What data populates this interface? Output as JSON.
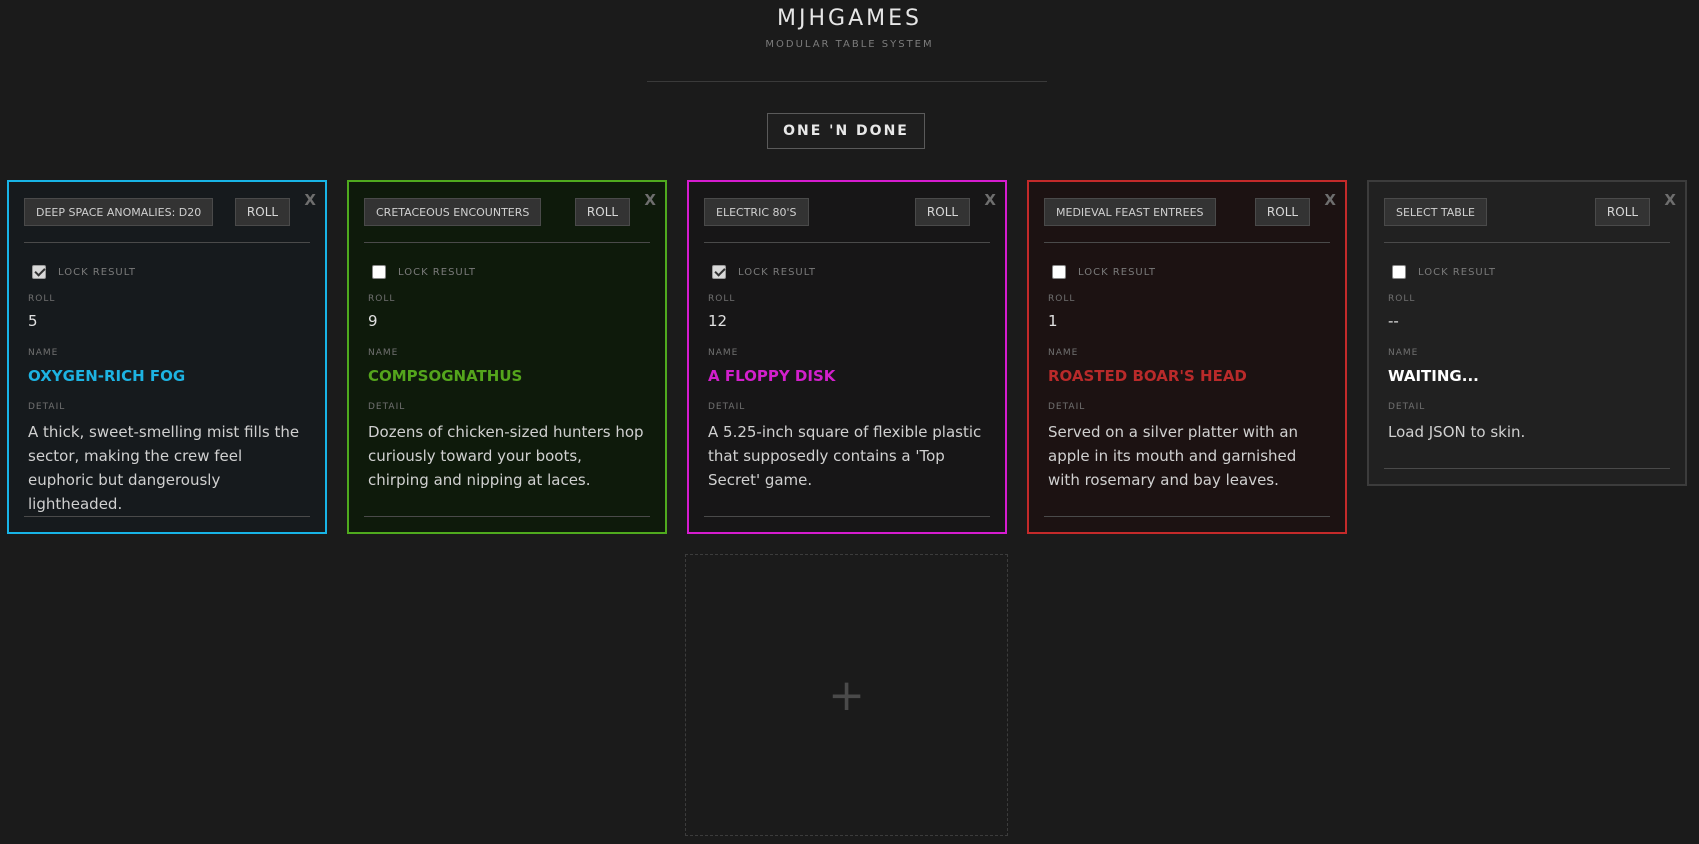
{
  "header": {
    "title": "MJHGAMES",
    "subtitle": "MODULAR TABLE SYSTEM",
    "main_button": "ONE 'N DONE"
  },
  "cards": [
    {
      "table": "DEEP SPACE ANOMALIES: D20",
      "roll_label": "ROLL",
      "close_label": "X",
      "lock_label": "LOCK RESULT",
      "locked": true,
      "roll_field_label": "ROLL",
      "roll": "5",
      "name_field_label": "NAME",
      "name": "OXYGEN-RICH FOG",
      "detail_field_label": "DETAIL",
      "detail": "A thick, sweet-smelling mist fills the sector, making the crew feel euphoric but dangerously lightheaded.",
      "accent": "#18b4e6",
      "background": "#161a1d",
      "name_color": "#1db3e2"
    },
    {
      "table": "CRETACEOUS ENCOUNTERS",
      "roll_label": "ROLL",
      "close_label": "X",
      "lock_label": "LOCK RESULT",
      "locked": false,
      "roll_field_label": "ROLL",
      "roll": "9",
      "name_field_label": "NAME",
      "name": "COMPSOGNATHUS",
      "detail_field_label": "DETAIL",
      "detail": "Dozens of chicken-sized hunters hop curiously toward your boots, chirping and nipping at laces.",
      "accent": "#4faa1e",
      "background": "#0e1a0b",
      "name_color": "#54a51c"
    },
    {
      "table": "ELECTRIC 80'S",
      "roll_label": "ROLL",
      "close_label": "X",
      "lock_label": "LOCK RESULT",
      "locked": true,
      "roll_field_label": "ROLL",
      "roll": "12",
      "name_field_label": "NAME",
      "name": "A FLOPPY DISK",
      "detail_field_label": "DETAIL",
      "detail": "A 5.25-inch square of flexible plastic that supposedly contains a 'Top Secret' game.",
      "accent": "#d51ccf",
      "background": "#171617",
      "name_color": "#d21fcc"
    },
    {
      "table": "MEDIEVAL FEAST ENTREES",
      "roll_label": "ROLL",
      "close_label": "X",
      "lock_label": "LOCK RESULT",
      "locked": false,
      "roll_field_label": "ROLL",
      "roll": "1",
      "name_field_label": "NAME",
      "name": "ROASTED BOAR'S HEAD",
      "detail_field_label": "DETAIL",
      "detail": "Served on a silver platter with an apple in its mouth and garnished with rosemary and bay leaves.",
      "accent": "#c42a2a",
      "background": "#1c1212",
      "name_color": "#b92a2a"
    },
    {
      "table": "SELECT TABLE",
      "roll_label": "ROLL",
      "close_label": "X",
      "lock_label": "LOCK RESULT",
      "locked": false,
      "roll_field_label": "ROLL",
      "roll": "--",
      "name_field_label": "NAME",
      "name": "WAITING...",
      "detail_field_label": "DETAIL",
      "detail": "Load JSON to skin.",
      "accent": "#3c3c3c",
      "background": "#212121",
      "name_color": "#ffffff"
    }
  ],
  "add_slot": {
    "icon": "plus-icon",
    "symbol": "+"
  }
}
